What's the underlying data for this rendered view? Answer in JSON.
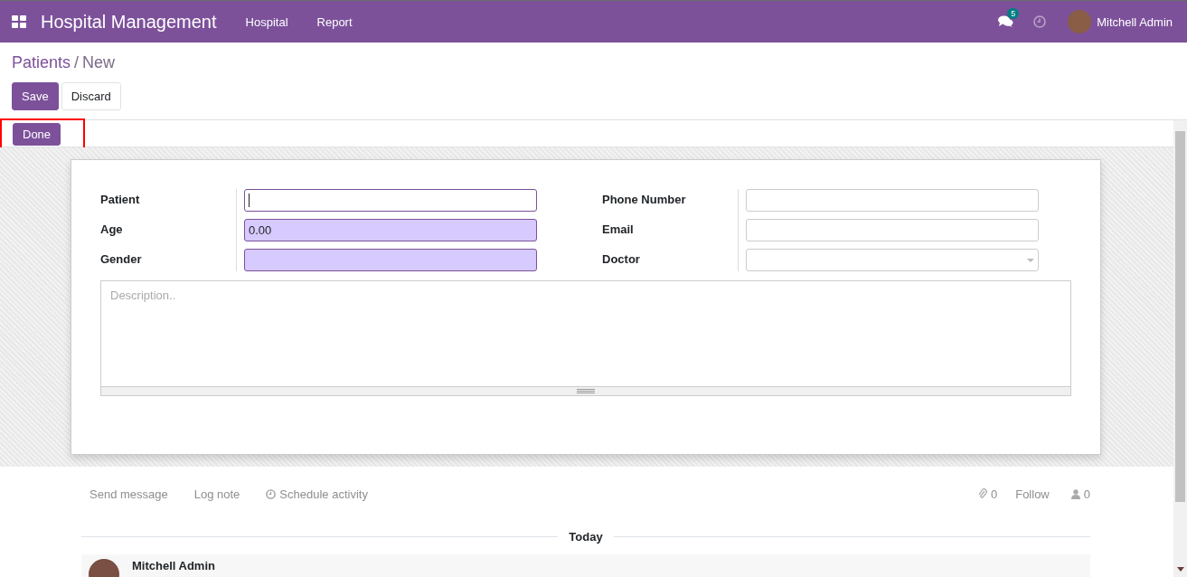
{
  "navbar": {
    "app_title": "Hospital Management",
    "menus": [
      "Hospital",
      "Report"
    ],
    "messages_badge": "5",
    "user_name": "Mitchell Admin"
  },
  "breadcrumb": {
    "parent": "Patients",
    "separator": "/",
    "current": "New"
  },
  "buttons": [
    {
      "label": "Save",
      "kind": "primary"
    },
    {
      "label": "Discard",
      "kind": "secondary"
    }
  ],
  "status_bar": {
    "button": "Done",
    "highlighted": true
  },
  "form": {
    "left_fields": [
      {
        "label": "Patient",
        "kind": "text",
        "required": false,
        "focused": true
      },
      {
        "label": "Age",
        "value": "0.00",
        "kind": "text",
        "required": true,
        "focused": false
      },
      {
        "label": "Gender",
        "kind": "text",
        "required": true,
        "focused": false
      }
    ],
    "right_fields": [
      {
        "label": "Phone Number",
        "kind": "text",
        "required": false,
        "focused": false
      },
      {
        "label": "Email",
        "kind": "text",
        "required": false,
        "focused": false
      },
      {
        "label": "Doctor",
        "kind": "dropdown",
        "required": false,
        "focused": false
      }
    ],
    "description": {
      "placeholder": "Description.."
    }
  },
  "chatter": {
    "actions": [
      "Send message",
      "Log note",
      "Schedule activity"
    ],
    "attachments": "0",
    "follow": "Follow",
    "followers": "0",
    "date_separator": "Today",
    "message_author": "Mitchell Admin"
  }
}
